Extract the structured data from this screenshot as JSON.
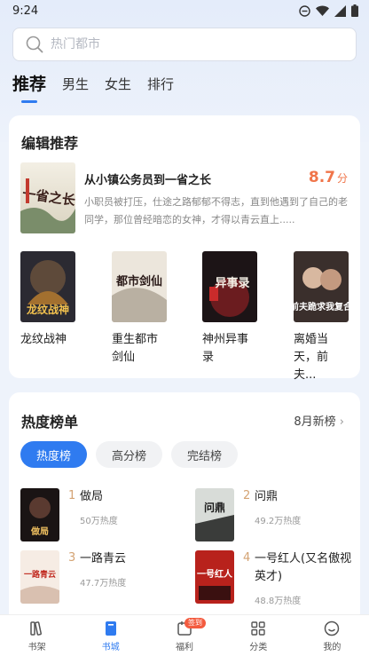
{
  "status": {
    "time": "9:24"
  },
  "search": {
    "placeholder": "热门都市"
  },
  "tabs": [
    {
      "label": "推荐",
      "active": true
    },
    {
      "label": "男生",
      "active": false
    },
    {
      "label": "女生",
      "active": false
    },
    {
      "label": "排行",
      "active": false
    }
  ],
  "editor": {
    "title": "编辑推荐",
    "featured": {
      "cover_text": "一省之长",
      "title": "从小镇公务员到一省之长",
      "score": "8.7",
      "score_unit": "分",
      "desc": "小职员被打压，仕途之路郁郁不得志，直到他遇到了自己的老同学，那位曾经暗恋的女神，才得以青云直上....."
    },
    "books": [
      {
        "name": "龙纹战神",
        "cover_text": "龙纹战神"
      },
      {
        "name": "重生都市剑仙",
        "cover_text": "都市剑仙"
      },
      {
        "name": "神州异事录",
        "cover_text": "异事录"
      },
      {
        "name": "离婚当天，前夫...",
        "cover_text": "前夫跪求我复合"
      }
    ]
  },
  "hot": {
    "title": "热度榜单",
    "more": "8月新榜",
    "chips": [
      {
        "label": "热度榜",
        "active": true
      },
      {
        "label": "高分榜",
        "active": false
      },
      {
        "label": "完结榜",
        "active": false
      }
    ],
    "items": [
      {
        "num": "1",
        "name": "做局",
        "heat": "50万热度",
        "cover_text": "做局"
      },
      {
        "num": "2",
        "name": "问鼎",
        "heat": "49.2万热度",
        "cover_text": "问鼎"
      },
      {
        "num": "3",
        "name": "一路青云",
        "heat": "47.7万热度",
        "cover_text": "一路青云"
      },
      {
        "num": "4",
        "name": "一号红人(又名傲视英才)",
        "heat": "48.8万热度",
        "cover_text": "一号红人"
      }
    ]
  },
  "nav": [
    {
      "label": "书架",
      "icon": "bookshelf-icon"
    },
    {
      "label": "书城",
      "icon": "bookstore-icon",
      "active": true
    },
    {
      "label": "福利",
      "icon": "calendar-icon",
      "badge": "签到"
    },
    {
      "label": "分类",
      "icon": "grid-icon"
    },
    {
      "label": "我的",
      "icon": "profile-icon"
    }
  ],
  "colors": {
    "accent": "#2f7bf0",
    "score": "#f0754a",
    "rank": "#d4a373"
  }
}
